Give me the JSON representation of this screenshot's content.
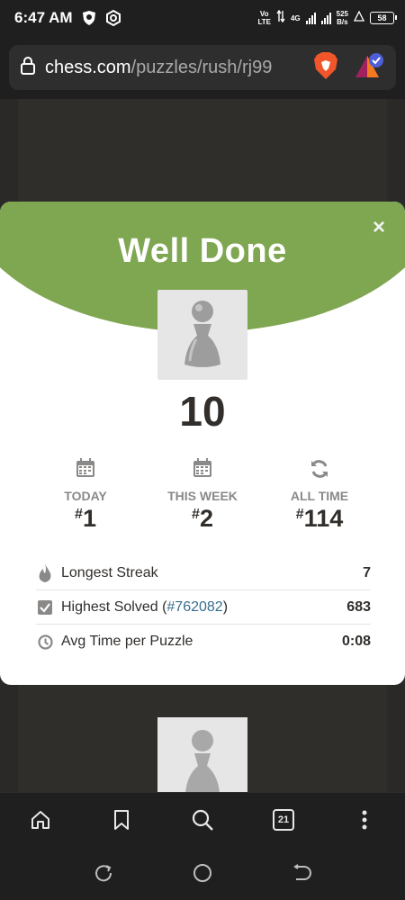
{
  "status_bar": {
    "time": "6:47 AM",
    "network_top": "Vo",
    "network_bottom": "LTE",
    "signal_type": "4G",
    "speed_value": "525",
    "speed_unit": "B/s",
    "battery": "58"
  },
  "browser": {
    "url_host": "chess.com",
    "url_path": "/puzzles/rush/rj99",
    "tab_count": "21"
  },
  "modal": {
    "title": "Well Done",
    "close_label": "×",
    "score": "10",
    "stats": [
      {
        "label": "TODAY",
        "hash": "#",
        "rank": "1"
      },
      {
        "label": "THIS WEEK",
        "hash": "#",
        "rank": "2"
      },
      {
        "label": "ALL TIME",
        "hash": "#",
        "rank": "114"
      }
    ],
    "rows": [
      {
        "label": "Longest Streak",
        "value": "7"
      },
      {
        "label_prefix": "Highest Solved (",
        "link": "#762082",
        "label_suffix": ")",
        "value": "683"
      },
      {
        "label": "Avg Time per Puzzle",
        "value": "0:08"
      }
    ]
  },
  "colors": {
    "header_green": "#7fa650",
    "link_blue": "#386e8f",
    "text_dark": "#312e2b"
  },
  "icons": [
    "brave-shield-icon",
    "settings-hex-icon",
    "lock-icon",
    "brave-lion-icon",
    "brave-rewards-icon",
    "calendar-icon",
    "refresh-icon",
    "flame-icon",
    "checkbox-icon",
    "clock-icon",
    "pawn-icon",
    "home-icon",
    "bookmark-icon",
    "search-icon",
    "menu-dots-icon"
  ]
}
